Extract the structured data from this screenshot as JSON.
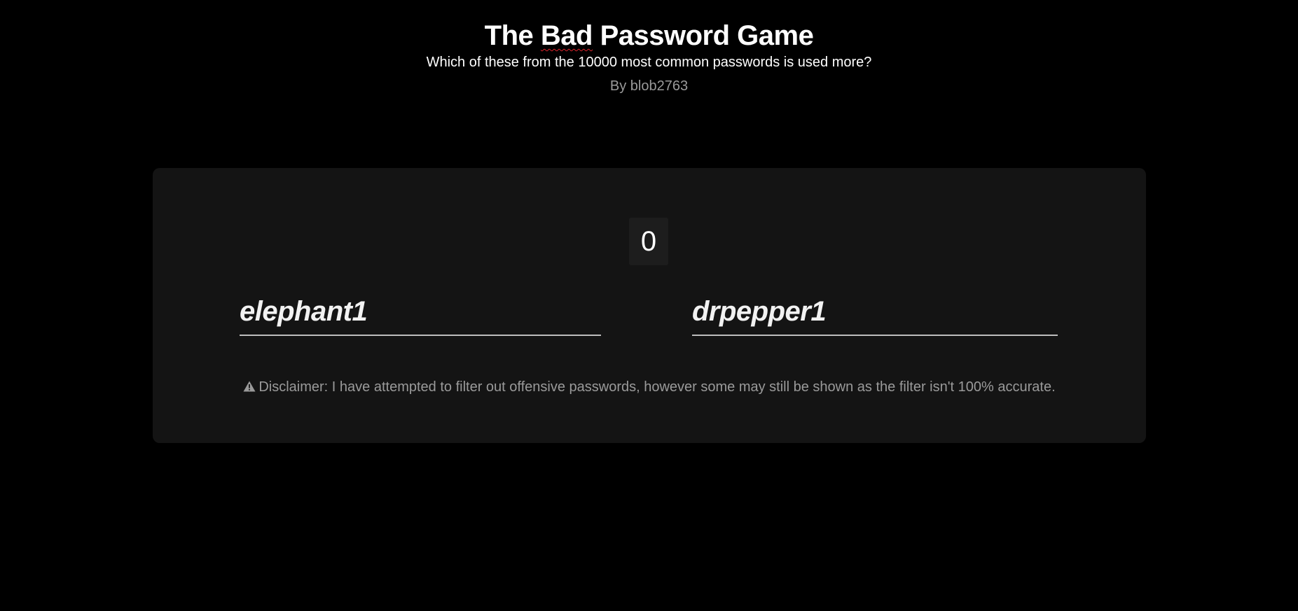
{
  "header": {
    "title_part1": "The ",
    "title_part2": "Bad",
    "title_part3": " Password Game",
    "subtitle": "Which of these from the 10000 most common passwords is used more?",
    "byline": "By blob2763"
  },
  "game": {
    "score": "0",
    "option_left": "elephant1",
    "option_right": "drpepper1",
    "disclaimer_icon": "warning-icon",
    "disclaimer": "Disclaimer: I have attempted to filter out offensive passwords, however some may still be shown as the filter isn't 100% accurate."
  },
  "colors": {
    "background": "#000000",
    "card": "#141414",
    "score_box": "#1d1d1d",
    "muted_text": "#9a9a9a",
    "spellcheck_underline": "#e0242c"
  }
}
